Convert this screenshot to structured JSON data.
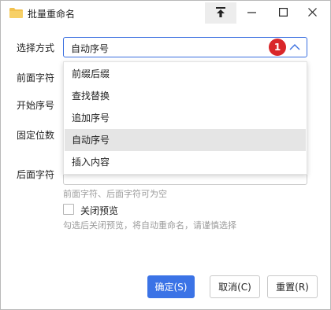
{
  "window": {
    "title": "批量重命名",
    "accent_color": "#3b73e6",
    "icons": [
      "folder-icon",
      "pin-top-icon",
      "minimize-icon",
      "maximize-icon",
      "close-icon"
    ]
  },
  "form": {
    "method_label": "选择方式",
    "prefix_label": "前面字符",
    "start_label": "开始序号",
    "digits_label": "固定位数",
    "suffix_label": "后面字符",
    "method_value": "自动序号",
    "badge": "1"
  },
  "dropdown": {
    "options": [
      "前缀后缀",
      "查找替换",
      "追加序号",
      "自动序号",
      "插入内容"
    ],
    "selected_index": 3
  },
  "hints": {
    "chars_hint": "前面字符、后面字符可为空",
    "preview_label": "关闭预览",
    "preview_hint": "勾选后关闭预览，将自动重命名，请谨慎选择"
  },
  "buttons": {
    "ok": "确定(S)",
    "cancel": "取消(C)",
    "reset": "重置(R)"
  }
}
